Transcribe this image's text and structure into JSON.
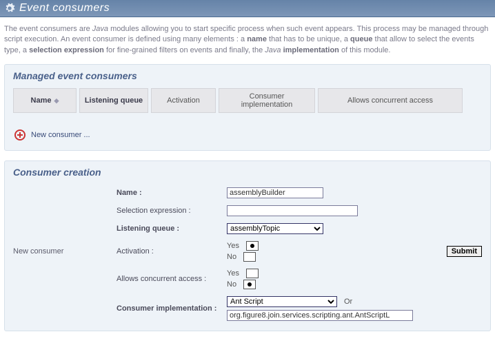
{
  "header": {
    "title": "Event consumers"
  },
  "intro": {
    "t1": "The event consumers are ",
    "java": "Java",
    "t2": " modules allowing you to start specific process when such event appears. This process may be managed through script execution. An event consumer is defined using many elements : a ",
    "name": "name",
    "t3": " that has to be unique, a ",
    "queue": "queue",
    "t4": " that allow to select the events type, a ",
    "sel": "selection expression",
    "t5": " for fine-grained filters on events and finally, the ",
    "java2": "Java",
    "impl": "implementation",
    "t6": " of this module."
  },
  "managed": {
    "title": "Managed event consumers",
    "columns": {
      "name": "Name",
      "queue": "Listening queue",
      "activation": "Activation",
      "impl": "Consumer implementation",
      "concurrent": "Allows concurrent access"
    },
    "new_link": "New consumer ..."
  },
  "creation": {
    "title": "Consumer creation",
    "side_label": "New consumer",
    "labels": {
      "name": "Name :",
      "selection": "Selection expression :",
      "queue": "Listening queue :",
      "activation": "Activation :",
      "concurrent": "Allows concurrent access :",
      "impl": "Consumer implementation :",
      "or": "Or"
    },
    "values": {
      "name": "assemblyBuilder",
      "selection": "",
      "queue_selected": "assemblyTopic",
      "impl_selected": "Ant Script",
      "impl_text": "org.figure8.join.services.scripting.ant.AntScriptL"
    },
    "radio": {
      "yes": "Yes",
      "no": "No"
    },
    "submit": "Submit"
  }
}
